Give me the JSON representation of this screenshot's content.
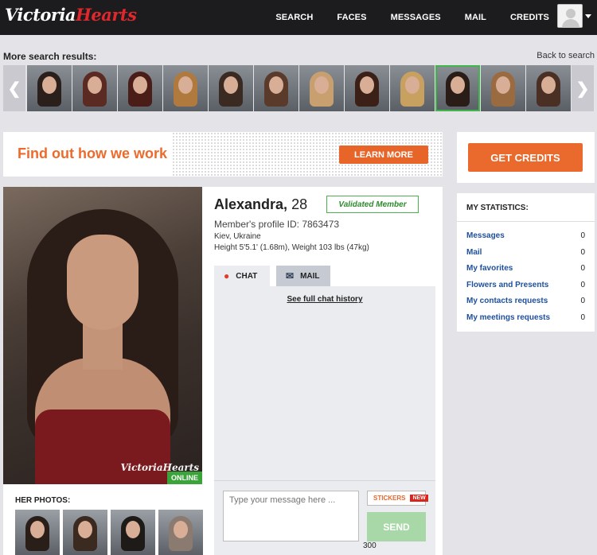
{
  "header": {
    "logo_main": "Victoria",
    "logo_accent": "Hearts",
    "nav": [
      "SEARCH",
      "FACES",
      "MESSAGES",
      "MAIL",
      "CREDITS"
    ]
  },
  "more_results": {
    "title": "More search results:",
    "back_link": "Back to search",
    "prev_arrow": "❮",
    "next_arrow": "❯",
    "thumb_colors": [
      "#2a1f1a",
      "#5b2a22",
      "#4a1d18",
      "#b07a3e",
      "#3a2a22",
      "#5a3a2a",
      "#c8a070",
      "#3b2018",
      "#c8a060",
      "#2a1c16",
      "#9a6a40",
      "#4a2f24"
    ],
    "active_index": 9
  },
  "banner": {
    "text": "Find out how we work",
    "button": "LEARN MORE"
  },
  "credits": {
    "button": "GET CREDITS"
  },
  "stats": {
    "title": "MY STATISTICS:",
    "rows": [
      {
        "label": "Messages",
        "value": "0"
      },
      {
        "label": "Mail",
        "value": "0"
      },
      {
        "label": "My favorites",
        "value": "0"
      },
      {
        "label": "Flowers and Presents",
        "value": "0"
      },
      {
        "label": "My contacts requests",
        "value": "0"
      },
      {
        "label": "My meetings requests",
        "value": "0"
      }
    ]
  },
  "profile": {
    "name": "Alexandra,",
    "age": "28",
    "validated": "Validated Member",
    "profile_id": "Member's profile ID: 7863473",
    "location": "Kiev, Ukraine",
    "height": "Height 5'5.1' (1.68m), Weight 103 lbs (47kg)",
    "watermark": "VictoriaHearts",
    "online": "ONLINE",
    "her_photos": "HER PHOTOS:",
    "small_thumb_colors": [
      "#2a1e18",
      "#3a2a20",
      "#1e1a18",
      "#8a7a70"
    ]
  },
  "chat": {
    "tab_chat": "CHAT",
    "tab_mail": "MAIL",
    "history": "See full chat history",
    "placeholder": "Type your message here ...",
    "stickers": "STICKERS",
    "new_badge": "NEW",
    "send": "SEND",
    "char_count": "300"
  }
}
